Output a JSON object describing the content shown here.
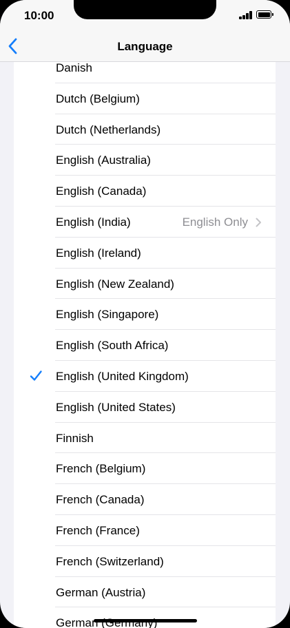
{
  "status_bar": {
    "time": "10:00"
  },
  "nav": {
    "title": "Language",
    "back_icon": "chevron-left-icon"
  },
  "colors": {
    "accent": "#147efb",
    "background": "#f2f2f7",
    "secondary_text": "#8e8e93"
  },
  "languages": [
    {
      "label": "Danish"
    },
    {
      "label": "Dutch (Belgium)"
    },
    {
      "label": "Dutch (Netherlands)"
    },
    {
      "label": "English (Australia)"
    },
    {
      "label": "English (Canada)"
    },
    {
      "label": "English (India)",
      "detail": "English Only"
    },
    {
      "label": "English (Ireland)"
    },
    {
      "label": "English (New Zealand)"
    },
    {
      "label": "English (Singapore)"
    },
    {
      "label": "English (South Africa)"
    },
    {
      "label": "English (United Kingdom)",
      "selected": true
    },
    {
      "label": "English (United States)"
    },
    {
      "label": "Finnish"
    },
    {
      "label": "French (Belgium)"
    },
    {
      "label": "French (Canada)"
    },
    {
      "label": "French (France)"
    },
    {
      "label": "French (Switzerland)"
    },
    {
      "label": "German (Austria)"
    },
    {
      "label": "German (Germany)"
    }
  ]
}
